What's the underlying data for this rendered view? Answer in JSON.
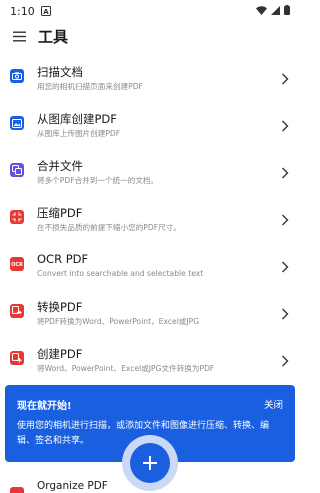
{
  "status_bar": {
    "time": "1:10",
    "left_icon": "a-notification-icon",
    "right_icons": [
      "wifi-icon",
      "signal-icon",
      "battery-icon"
    ]
  },
  "app_bar": {
    "title": "工具",
    "menu_icon": "hamburger-menu-icon"
  },
  "tools": [
    {
      "title": "扫描文档",
      "subtitle": "用您的相机扫描页面来创建PDF",
      "icon": "camera-icon",
      "color": "#1a5fe0"
    },
    {
      "title": "从图库创建PDF",
      "subtitle": "从图库上传图片创建PDF",
      "icon": "image-icon",
      "color": "#1a5fe0"
    },
    {
      "title": "合并文件",
      "subtitle": "将多个PDF合并到一个统一的文档。",
      "icon": "merge-icon",
      "color": "#6a4fd8"
    },
    {
      "title": "压缩PDF",
      "subtitle": "在不损失品质的前提下缩小您的PDF尺寸。",
      "icon": "compress-icon",
      "color": "#e53935"
    },
    {
      "title": "OCR PDF",
      "subtitle": "Convert into searchable and selectable text",
      "icon": "ocr-icon",
      "color": "#e53935"
    },
    {
      "title": "转换PDF",
      "subtitle": "将PDF转换为Word、PowerPoint，Excel或JPG",
      "icon": "convert-icon",
      "color": "#e53935"
    },
    {
      "title": "创建PDF",
      "subtitle": "将Word、PowerPoint、Excel或JPG文件转换为PDF",
      "icon": "create-pdf-icon",
      "color": "#e53935"
    }
  ],
  "banner": {
    "title": "现在就开始!",
    "close_label": "关闭",
    "body": "使用您的相机进行扫描，或添加文件和图像进行压缩、转换、编辑、签名和共享。"
  },
  "peek_item": {
    "title": "Organize PDF",
    "color": "#e53935"
  },
  "fab": {
    "icon": "plus-icon",
    "color": "#1a5fe0"
  }
}
